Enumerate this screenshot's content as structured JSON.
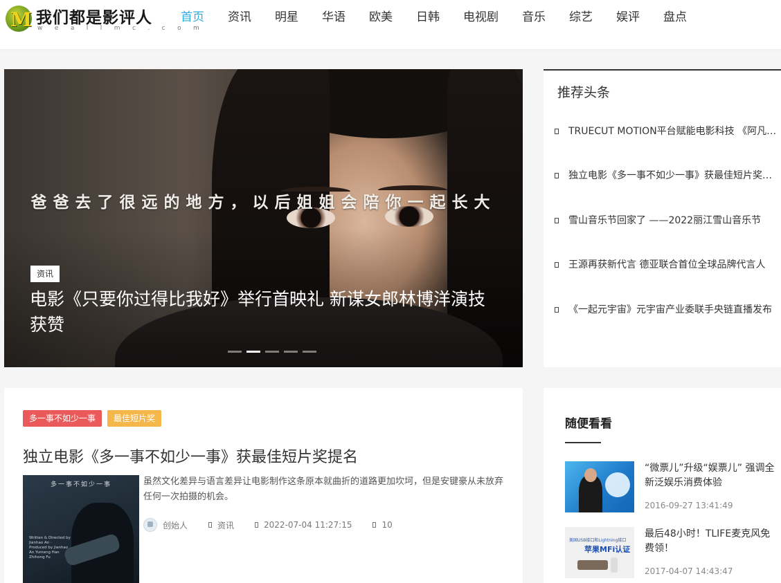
{
  "site": {
    "logo_letter": "M",
    "title": "我们都是影评人",
    "domain": "w e a l l m c . c o m"
  },
  "nav": {
    "items": [
      {
        "label": "首页",
        "active": true
      },
      {
        "label": "资讯"
      },
      {
        "label": "明星"
      },
      {
        "label": "华语"
      },
      {
        "label": "欧美"
      },
      {
        "label": "日韩"
      },
      {
        "label": "电视剧"
      },
      {
        "label": "音乐"
      },
      {
        "label": "综艺"
      },
      {
        "label": "娱评"
      },
      {
        "label": "盘点"
      }
    ]
  },
  "slider": {
    "quote": "爸爸去了很远的地方，以后姐姐会陪你一起长大",
    "tag": "资讯",
    "title": "电影《只要你过得比我好》举行首映礼 新谋女郎林博洋演技获赞",
    "dot_count": 5,
    "active_index": 1
  },
  "recommend": {
    "heading": "推荐头条",
    "items": [
      "TRUECUT MOTION平台赋能电影科技 《阿凡达：水之道》",
      "独立电影《多一事不如少一事》获最佳短片奖提名",
      "雪山音乐节回家了 ——2022丽江雪山音乐节",
      "王源再获新代言 德亚联合首位全球品牌代言人",
      "《一起元宇宙》元宇宙产业委联手央链直播发布"
    ]
  },
  "article": {
    "tags": [
      "多一事不如少一事",
      "最佳短片奖"
    ],
    "title": "独立电影《多一事不如少一事》获最佳短片奖提名",
    "thumb_title": "多一事不如少一事",
    "thumb_credits": "Written & Directed by Jianhao An · Produced by Jianhao An Yumeng Han Zhihong Fu",
    "excerpt": "虽然文化差异与语言差异让电影制作这条原本就曲折的道路更加坎坷，但是安键豪从未放弃任何一次拍摄的机会。",
    "author": "创始人",
    "category": "资讯",
    "date": "2022-07-04 11:27:15",
    "views": "10"
  },
  "random": {
    "heading": "随便看看",
    "items": [
      {
        "title": "“微票儿”升级“娱票儿” 强调全新泛娱乐消费体验",
        "time": "2016-09-27 13:41:49"
      },
      {
        "title": "最后48小时！TLIFE麦克风免费领！",
        "time": "2017-04-07 14:43:47",
        "img_text_1": "美国USB接口和Lightning接口",
        "img_text_2": "苹果MFi认证"
      }
    ]
  },
  "colors": {
    "accent": "#2eaae1",
    "tag_red": "#ea5a5a",
    "tag_orange": "#f5b74a"
  }
}
